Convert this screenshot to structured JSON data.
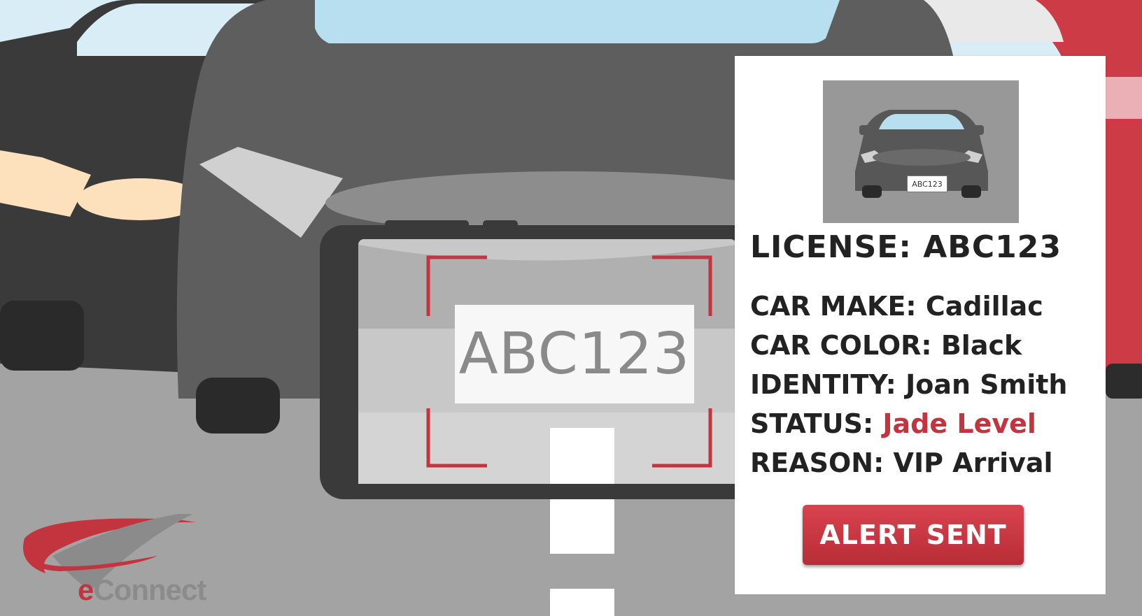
{
  "scene": {
    "phone_plate_text": "ABC123"
  },
  "card": {
    "thumbnail_plate_text": "ABC123",
    "license_label": "LICENSE:",
    "license_value": "ABC123",
    "details": [
      {
        "label": "CAR MAKE:",
        "value": "Cadillac"
      },
      {
        "label": "CAR COLOR:",
        "value": "Black"
      },
      {
        "label": "IDENTITY:",
        "value": "Joan Smith"
      },
      {
        "label": "STATUS:",
        "value": "Jade Level"
      },
      {
        "label": "REASON:",
        "value": "VIP Arrival"
      }
    ],
    "alert_button_label": "ALERT SENT"
  },
  "logo": {
    "e": "e",
    "rest": "Connect"
  },
  "colors": {
    "accent_red": "#c2353f",
    "sky": "#d8edf6",
    "car_dark": "#3a3a3a",
    "car_mid": "#575757",
    "road": "#a3a3a3"
  }
}
